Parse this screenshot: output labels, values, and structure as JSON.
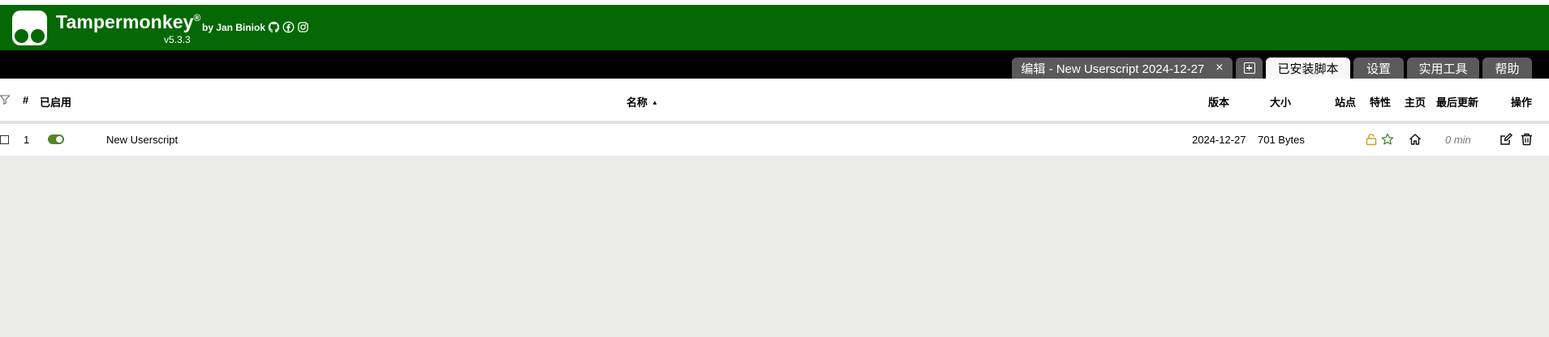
{
  "header": {
    "app_name": "Tampermonkey",
    "registered_mark": "®",
    "byline": "by Jan Biniok",
    "version": "v5.3.3",
    "social_icons": [
      "github-icon",
      "facebook-icon",
      "instagram-icon"
    ],
    "brand_color": "#056805"
  },
  "tabs": [
    {
      "label": "编辑 - New Userscript 2024-12-27",
      "close": "×",
      "active": false
    },
    {
      "icon": "add-icon",
      "active": false
    },
    {
      "label": "已安装脚本",
      "active": true
    },
    {
      "label": "设置",
      "active": false
    },
    {
      "label": "实用工具",
      "active": false
    },
    {
      "label": "帮助",
      "active": false
    }
  ],
  "table": {
    "columns": {
      "filter_icon": "filter-icon",
      "index": "#",
      "enabled": "已启用",
      "name": "名称",
      "sort_indicator": "▲",
      "version": "版本",
      "size": "大小",
      "sites": "站点",
      "features": "特性",
      "homepage": "主页",
      "last_updated": "最后更新",
      "actions": "操作"
    },
    "rows": [
      {
        "index": "1",
        "enabled": true,
        "name": "New Userscript",
        "version": "2024-12-27",
        "size": "701 Bytes",
        "features": [
          "lock-icon",
          "star-icon"
        ],
        "homepage_icon": "home-icon",
        "last_updated": "0 min",
        "actions": [
          "edit-icon",
          "trash-icon"
        ]
      }
    ]
  }
}
